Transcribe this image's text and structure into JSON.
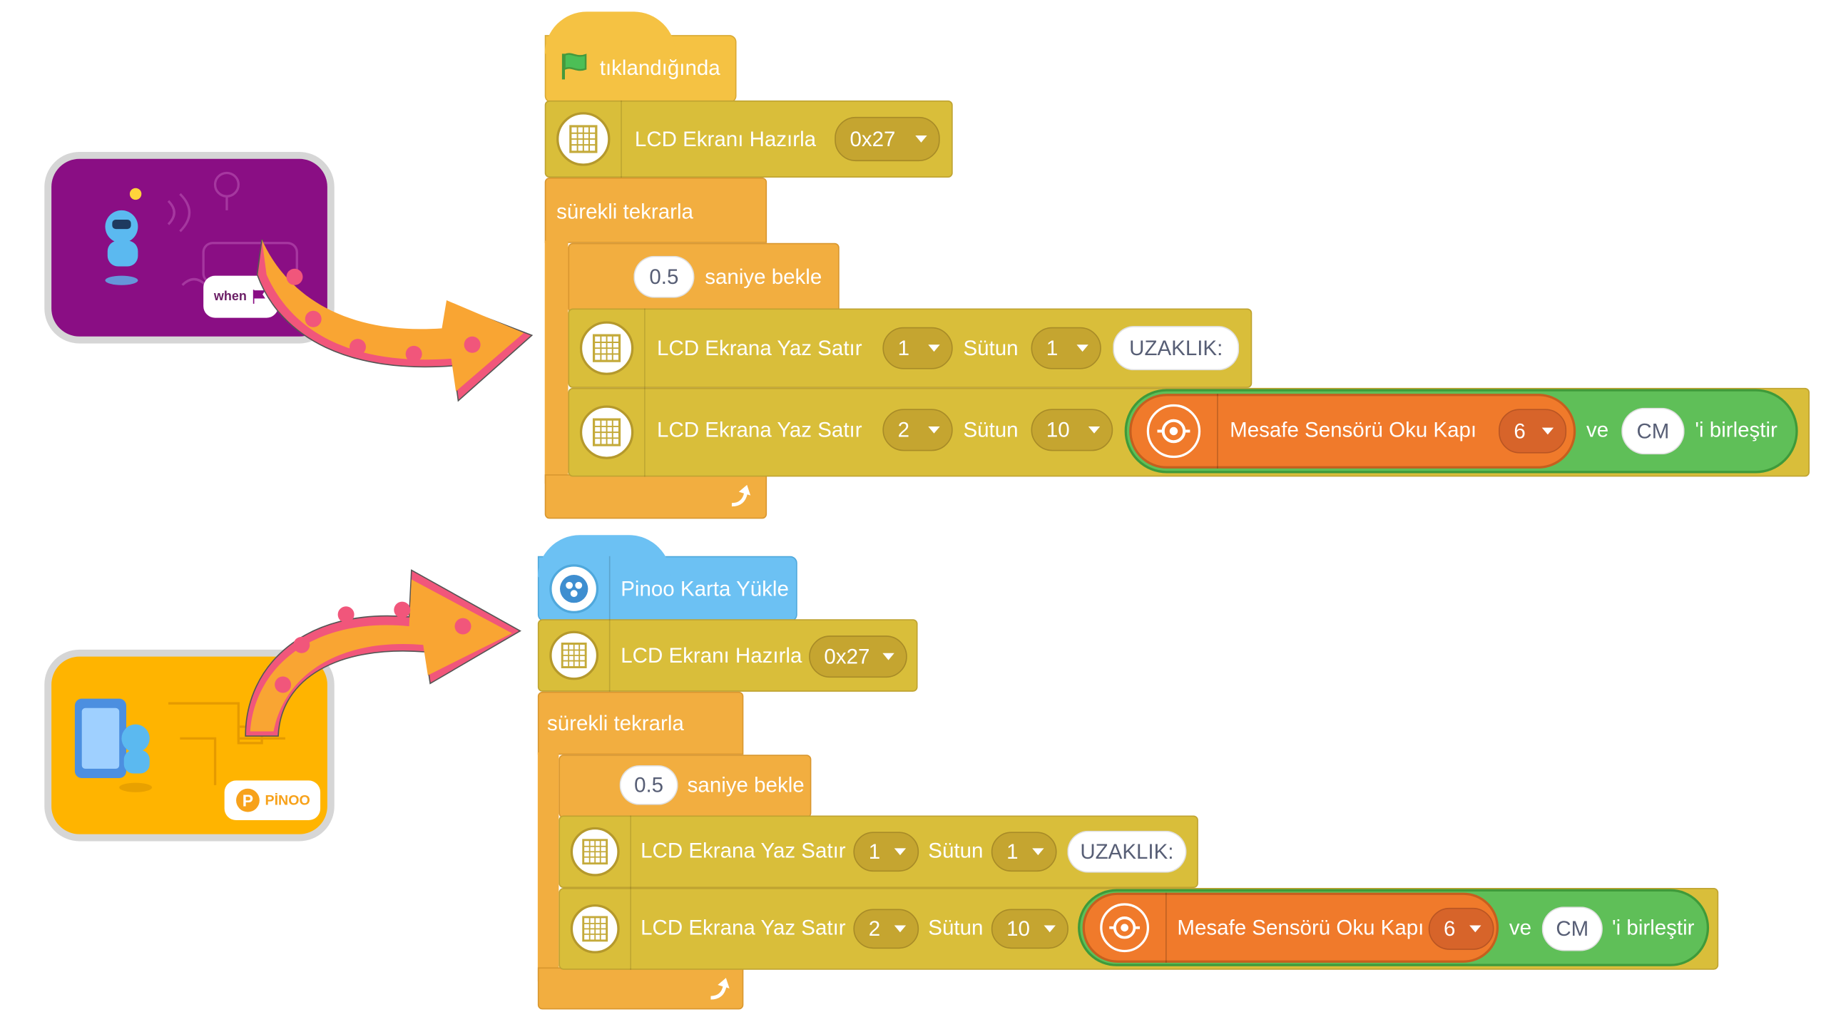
{
  "colors": {
    "lcd_block": "#D9BE3A",
    "control_block": "#F2AE40",
    "event_block": "#F5C243",
    "pinoo_block": "#6CC1F3",
    "join_block": "#5FBF58",
    "sensor_block": "#F07A2B",
    "card_purple": "#8A0E84",
    "card_yellow": "#FFB400",
    "arrow_orange": "#F9A533",
    "arrow_pink": "#F1567B"
  },
  "cards": {
    "top": {
      "tag_text": "when",
      "icon": "green-flag-icon"
    },
    "bottom": {
      "tag_text": "PİNOO",
      "icon": "pinoo-logo-icon"
    }
  },
  "top": {
    "hat_label": "tıklandığında",
    "init_label": "LCD Ekranı Hazırla",
    "init_addr": "0x27",
    "forever_label": "sürekli tekrarla",
    "wait_value": "0.5",
    "wait_label": "saniye bekle",
    "write1_label": "LCD Ekrana Yaz Satır",
    "write1_row": "1",
    "write1_col_label": "Sütun",
    "write1_col": "1",
    "write1_text": "UZAKLIK:",
    "write2_label": "LCD Ekrana Yaz Satır",
    "write2_row": "2",
    "write2_col_label": "Sütun",
    "write2_col": "10",
    "sensor_label": "Mesafe Sensörü Oku Kapı",
    "sensor_port": "6",
    "join_ve": "ve",
    "join_value": "CM",
    "join_label": "'i birleştir"
  },
  "bottom": {
    "hat_label": "Pinoo Karta Yükle",
    "init_label": "LCD Ekranı Hazırla",
    "init_addr": "0x27",
    "forever_label": "sürekli tekrarla",
    "wait_value": "0.5",
    "wait_label": "saniye bekle",
    "write1_label": "LCD Ekrana Yaz Satır",
    "write1_row": "1",
    "write1_col_label": "Sütun",
    "write1_col": "1",
    "write1_text": "UZAKLIK:",
    "write2_label": "LCD Ekrana Yaz Satır",
    "write2_row": "2",
    "write2_col_label": "Sütun",
    "write2_col": "10",
    "sensor_label": "Mesafe Sensörü Oku Kapı",
    "sensor_port": "6",
    "join_ve": "ve",
    "join_value": "CM",
    "join_label": "'i birleştir"
  }
}
